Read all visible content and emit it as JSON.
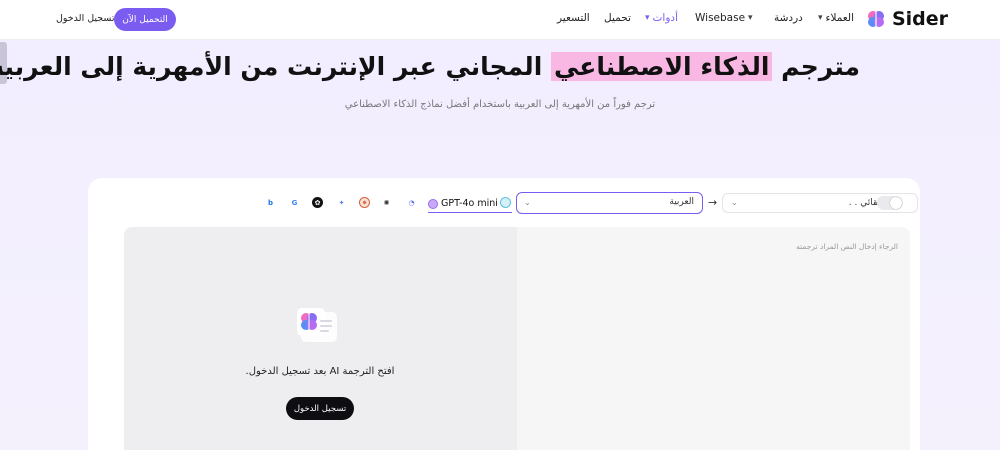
{
  "header": {
    "logo_text": "Sider",
    "nav": {
      "customers": "العملاء",
      "chat": "دردشة",
      "wisebase": "Wisebase",
      "tools": "أدوات",
      "download": "تحميل",
      "pricing": "التسعير"
    },
    "install_button": "التحميل الآن",
    "login_link": "تسجيل الدخول"
  },
  "hero": {
    "title_part1": "مترجم ",
    "title_highlight": "الذكاء الاصطناعي",
    "title_part2": " المجاني عبر الإنترنت من الأمهرية إلى العربية",
    "subtitle": "ترجم فوراً من الأمهرية إلى العربية باستخدام أفضل نماذج الذكاء الاصطناعي"
  },
  "translator": {
    "toggle_label": "تلقائي . .",
    "source_language": "",
    "target_language": "العربية",
    "active_model": "GPT-4o mini",
    "models": [
      "bing-icon",
      "google-icon",
      "openai-icon",
      "gemini-icon",
      "claude-icon",
      "deepseek-icon",
      "nova-icon"
    ],
    "input_placeholder": "الرجاء إدخال النص المراد ترجمته",
    "login_message": "افتح الترجمة AI بعد تسجيل الدخول.",
    "login_button": "تسجيل الدخول"
  },
  "colors": {
    "accent": "#7b5cf0",
    "highlight": "#f9b8e4",
    "hero_bg": "#f2eeff",
    "dark_button": "#0e0e12"
  }
}
